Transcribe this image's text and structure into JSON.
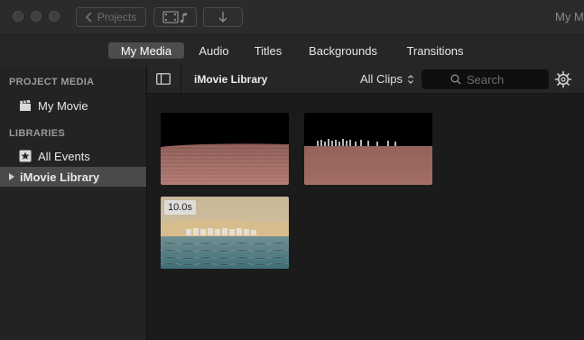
{
  "window": {
    "title": "My M",
    "back_label": "Projects"
  },
  "tabs": [
    {
      "label": "My Media",
      "active": true
    },
    {
      "label": "Audio",
      "active": false
    },
    {
      "label": "Titles",
      "active": false
    },
    {
      "label": "Backgrounds",
      "active": false
    },
    {
      "label": "Transitions",
      "active": false
    }
  ],
  "sidebar": {
    "project_media_heading": "PROJECT MEDIA",
    "project_item": "My Movie",
    "libraries_heading": "LIBRARIES",
    "all_events": "All Events",
    "library_item": "iMovie Library"
  },
  "browser": {
    "library_title": "iMovie Library",
    "filter": "All Clips",
    "search_placeholder": "Search"
  },
  "clips": [
    {
      "kind": "desert-dark",
      "duration": ""
    },
    {
      "kind": "desert-dark-2",
      "duration": ""
    },
    {
      "kind": "beach",
      "duration": "10.0s"
    }
  ],
  "colors": {
    "accent": "#4d4d4d",
    "selection": "#4a4a4a"
  }
}
